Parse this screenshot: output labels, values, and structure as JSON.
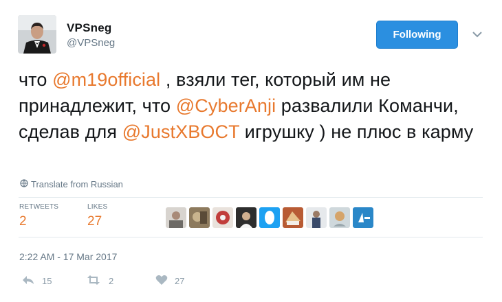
{
  "author": {
    "name": "VPSneg",
    "handle": "@VPSneg"
  },
  "follow_button": {
    "label": "Following"
  },
  "tweet": {
    "segments": [
      {
        "text": "что ",
        "type": "text"
      },
      {
        "text": "@m19official",
        "type": "mention"
      },
      {
        "text": " , взяли тег, который им не принадлежит, что ",
        "type": "text"
      },
      {
        "text": "@CyberAnji",
        "type": "mention"
      },
      {
        "text": " развалили Команчи, сделав для ",
        "type": "text"
      },
      {
        "text": "@JustXBOCT",
        "type": "mention"
      },
      {
        "text": " игрушку ) не плюс в карму",
        "type": "text"
      }
    ]
  },
  "translate_label": "Translate from Russian",
  "stats": {
    "retweets_label": "RETWEETS",
    "retweets_value": "2",
    "likes_label": "LIKES",
    "likes_value": "27"
  },
  "likers": [
    "liker-1",
    "liker-2",
    "liker-3",
    "liker-4",
    "liker-5",
    "liker-6",
    "liker-7",
    "liker-8",
    "liker-9"
  ],
  "timestamp": "2:22 AM - 17 Mar 2017",
  "actions": {
    "reply_count": "15",
    "retweet_count": "2",
    "like_count": "27"
  },
  "colors": {
    "mention": "#e8792e",
    "follow_button": "#2b8fe0",
    "muted": "#657786"
  },
  "icons": [
    "globe-icon",
    "chevron-down-icon",
    "reply-icon",
    "retweet-icon",
    "heart-icon"
  ]
}
